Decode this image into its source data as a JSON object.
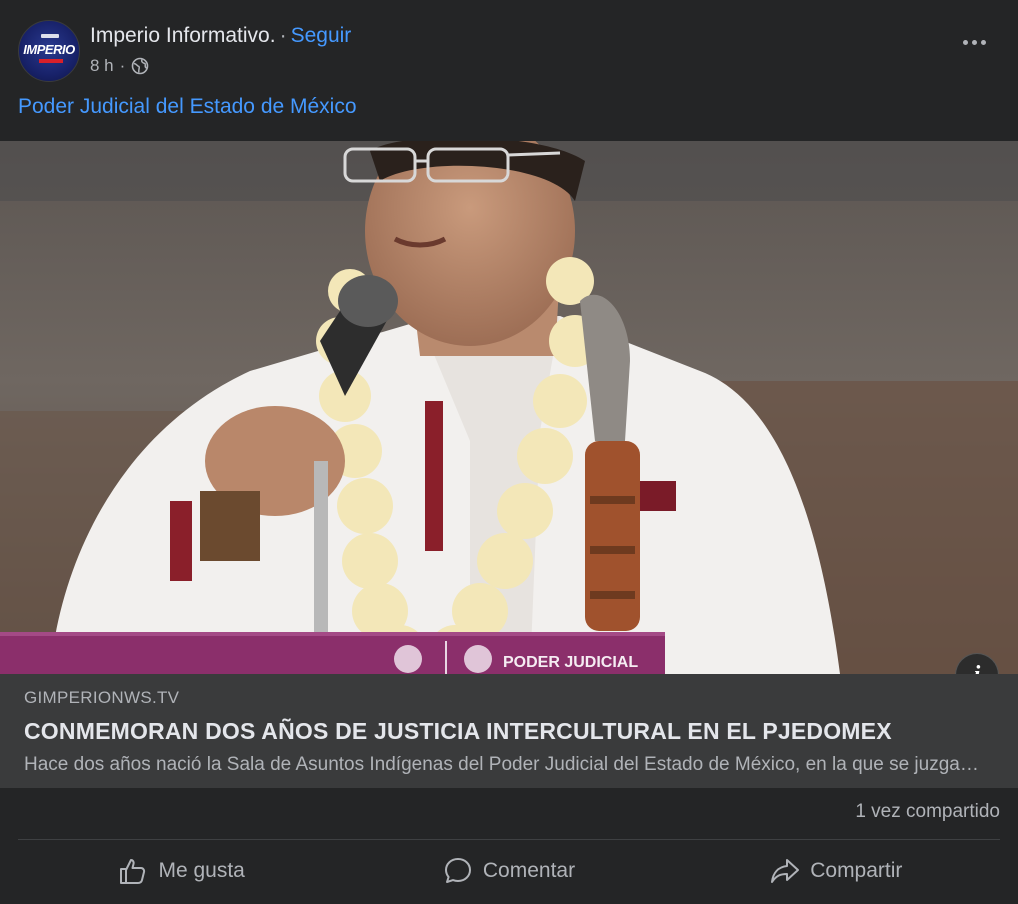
{
  "post": {
    "page_name": "Imperio Informativo.",
    "separator": "·",
    "follow_label": "Seguir",
    "time": "8 h",
    "time_separator": "·",
    "privacy_icon": "globe-icon",
    "more_icon": "more-options-icon",
    "text": "Poder Judicial del Estado de México",
    "avatar_text": "IMPERIO"
  },
  "photo": {
    "podium_text": "PODER JUDICIAL",
    "info_icon": "i"
  },
  "link_preview": {
    "domain": "GIMPERIONWS.TV",
    "headline": "CONMEMORAN DOS AÑOS DE JUSTICIA INTERCULTURAL EN EL PJEDOMEX",
    "description": "Hace dos años nació la Sala de Asuntos Indígenas del Poder Judicial del Estado de México, en la que se juzga con perspectiva intercultural"
  },
  "stats": {
    "shares": "1 vez compartido"
  },
  "actions": {
    "like": "Me gusta",
    "comment": "Comentar",
    "share": "Compartir"
  },
  "colors": {
    "background": "#242526",
    "link_blue": "#4599ff",
    "preview_bg": "#3a3b3c",
    "secondary_text": "#b0b3b8"
  }
}
